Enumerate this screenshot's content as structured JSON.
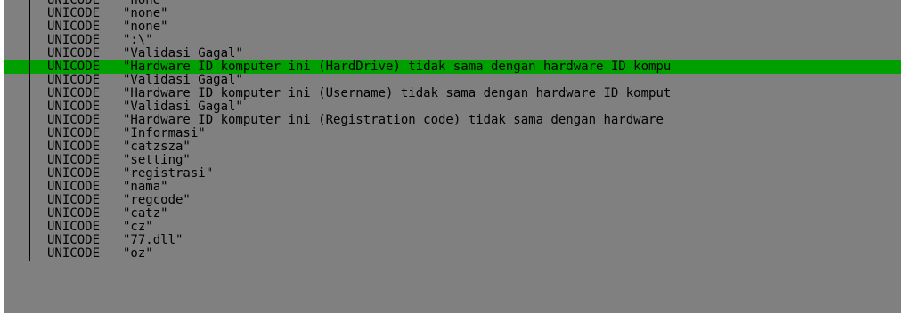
{
  "window": {
    "listing": {
      "rows": [
        {
          "directive": "UNICODE",
          "text": "\"none\"",
          "selected": false
        },
        {
          "directive": "UNICODE",
          "text": "\"none\"",
          "selected": false
        },
        {
          "directive": "UNICODE",
          "text": "\"none\"",
          "selected": false
        },
        {
          "directive": "UNICODE",
          "text": "\":\\\"",
          "selected": false
        },
        {
          "directive": "UNICODE",
          "text": "\"Validasi Gagal\"",
          "selected": false
        },
        {
          "directive": "UNICODE",
          "text": "\"Hardware ID komputer ini (HardDrive) tidak sama dengan hardware ID kompu",
          "selected": true
        },
        {
          "directive": "UNICODE",
          "text": "\"Validasi Gagal\"",
          "selected": false
        },
        {
          "directive": "UNICODE",
          "text": "\"Hardware ID komputer ini (Username) tidak sama dengan hardware ID komput",
          "selected": false
        },
        {
          "directive": "UNICODE",
          "text": "\"Validasi Gagal\"",
          "selected": false
        },
        {
          "directive": "UNICODE",
          "text": "\"Hardware ID komputer ini (Registration code) tidak sama dengan hardware",
          "selected": false
        },
        {
          "directive": "UNICODE",
          "text": "\"Informasi\"",
          "selected": false
        },
        {
          "directive": "UNICODE",
          "text": "\"catzsza\"",
          "selected": false
        },
        {
          "directive": "UNICODE",
          "text": "\"setting\"",
          "selected": false
        },
        {
          "directive": "UNICODE",
          "text": "\"registrasi\"",
          "selected": false
        },
        {
          "directive": "UNICODE",
          "text": "\"nama\"",
          "selected": false
        },
        {
          "directive": "UNICODE",
          "text": "\"regcode\"",
          "selected": false
        },
        {
          "directive": "UNICODE",
          "text": "\"catz\"",
          "selected": false
        },
        {
          "directive": "UNICODE",
          "text": "\"cz\"",
          "selected": false
        },
        {
          "directive": "UNICODE",
          "text": "\"77.dll\"",
          "selected": false
        },
        {
          "directive": "UNICODE",
          "text": "\"oz\"",
          "selected": false
        }
      ]
    },
    "colors": {
      "background": "#808080",
      "selection": "#00a000",
      "text": "#000000"
    }
  }
}
